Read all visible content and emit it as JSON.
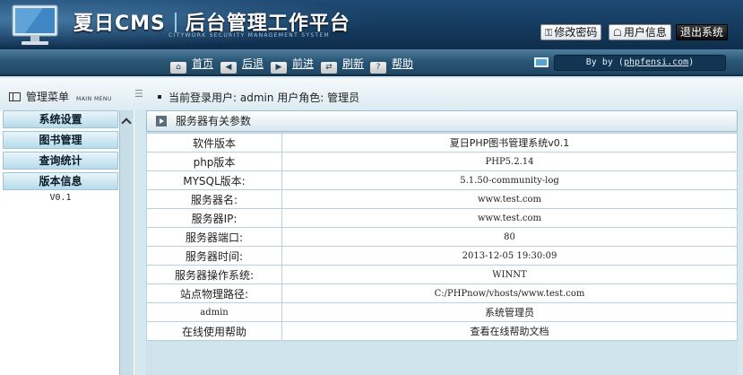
{
  "header": {
    "brand_cms": "夏日CMS",
    "brand_title": "后台管理工作平台",
    "subtitle": "CITYWORK SECURITY MANAGEMENT SYSTEM",
    "buttons": {
      "change_password": "修改密码",
      "user_info": "用户信息",
      "logout": "退出系统"
    }
  },
  "nav": {
    "home": "首页",
    "back": "后退",
    "forward": "前进",
    "refresh": "刷新",
    "help": "帮助",
    "byline_prefix": "By by (",
    "byline_link": "phpfensi.com",
    "byline_suffix": ")"
  },
  "menu": {
    "title": "管理菜单",
    "title_en": "MAIN MENU",
    "items": [
      "系统设置",
      "图书管理",
      "查询统计",
      "版本信息"
    ],
    "version": "V0.1"
  },
  "status": {
    "current_user_text": "当前登录用户: admin  用户角色: 管理员"
  },
  "panel": {
    "title": "服务器有关参数",
    "rows": [
      {
        "key": "软件版本",
        "value": "夏日PHP图书管理系统v0.1"
      },
      {
        "key": "php版本",
        "value": "PHP5.2.14"
      },
      {
        "key": "MYSQL版本:",
        "value": "5.1.50-community-log"
      },
      {
        "key": "服务器名:",
        "value": "www.test.com"
      },
      {
        "key": "服务器IP:",
        "value": "www.test.com"
      },
      {
        "key": "服务器端口:",
        "value": "80"
      },
      {
        "key": "服务器时间:",
        "value": "2013-12-05 19:30:09"
      },
      {
        "key": "服务器操作系统:",
        "value": "WINNT"
      },
      {
        "key": "站点物理路径:",
        "value": "C:/PHPnow/vhosts/www.test.com"
      },
      {
        "key": "admin",
        "value": "系统管理员"
      },
      {
        "key": "在线使用帮助",
        "value": "查看在线帮助文档"
      }
    ]
  },
  "icons": {
    "monitor": "monitor-icon",
    "change_password": "key-icon",
    "user_info": "user-icon",
    "home": "home-icon",
    "back": "arrow-left-icon",
    "forward": "arrow-right-icon",
    "refresh": "refresh-icon",
    "help": "question-icon"
  },
  "colors": {
    "header_bg": "#153a5e",
    "nav_bg": "#2b5776",
    "menu_item_bg": "#b6dbea",
    "page_bg": "#d6e8ef"
  }
}
